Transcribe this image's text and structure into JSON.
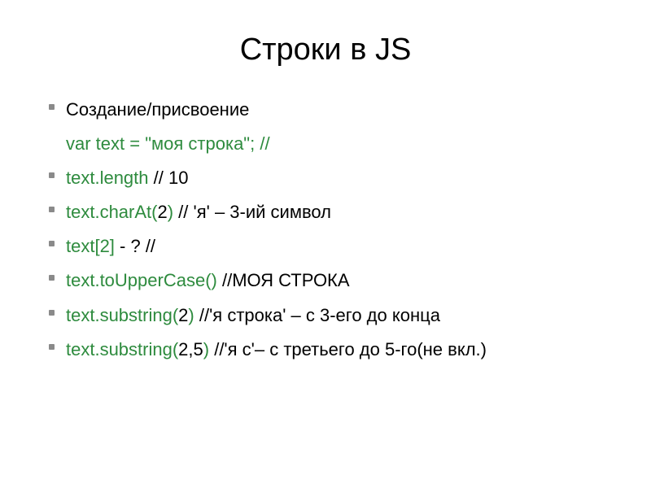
{
  "title": "Строки в JS",
  "lines": {
    "l1": "Создание/присвоение",
    "l2_a": "var text = ",
    "l2_b": "\"моя строка\"",
    "l2_c": "; //",
    "l3_a": "text.length",
    "l3_b": " // 10",
    "l4_a": "text.charAt(",
    "l4_b": "2",
    "l4_c": ")",
    "l4_d": " // 'я' – 3-ий символ",
    "l5_a": "text[2]",
    "l5_b": " - ? //",
    "l6_a": "text.toUpperCase()",
    "l6_b": " //МОЯ СТРОКА",
    "l7_a": "text.substring(",
    "l7_b": "2",
    "l7_c": ")",
    "l7_d": " //'я строка'  – с 3-его  до конца",
    "l8_a": "text.substring(",
    "l8_b": "2,5",
    "l8_c": ")",
    "l8_d": " //'я с'– с третьего до 5-го(не вкл.)"
  }
}
